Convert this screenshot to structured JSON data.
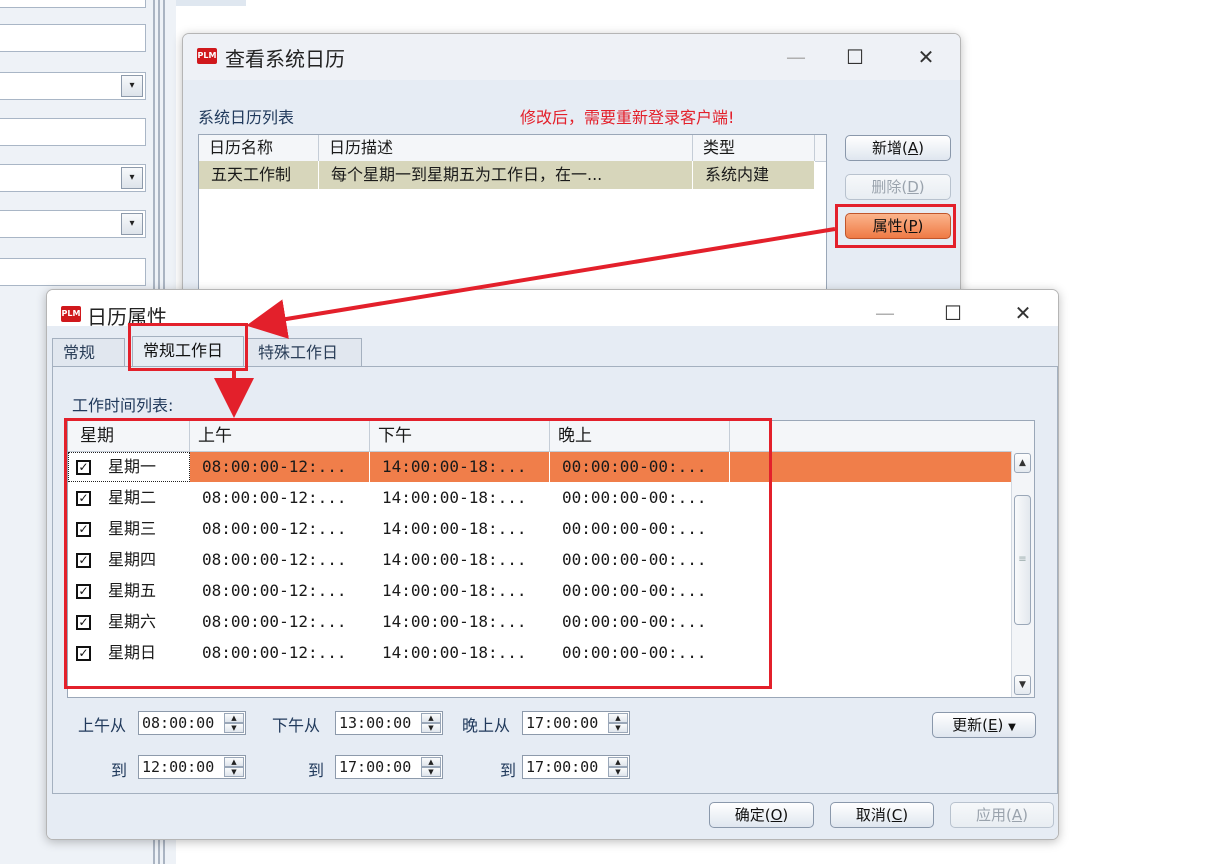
{
  "background": {
    "combo_arrow": "▾"
  },
  "system_calendar_window": {
    "title": "查看系统日历",
    "app_icon_text": "PLM",
    "list_label": "系统日历列表",
    "warning": "修改后，需要重新登录客户端!",
    "warning_color": "#e3202b",
    "columns": [
      "日历名称",
      "日历描述",
      "类型"
    ],
    "rows": [
      [
        "五天工作制",
        "每个星期一到星期五为工作日，在一...",
        "系统内建"
      ]
    ],
    "buttons": {
      "add": "新增",
      "add_key": "A",
      "delete": "删除",
      "delete_key": "D",
      "properties": "属性",
      "properties_key": "P"
    },
    "caption": {
      "minimize": "—",
      "maximize": "☐",
      "close": "✕"
    }
  },
  "calendar_props_window": {
    "title": "日历属性",
    "app_icon_text": "PLM",
    "tabs": [
      "常规",
      "常规工作日",
      "特殊工作日"
    ],
    "active_tab": "常规工作日",
    "list_label": "工作时间列表:",
    "columns": [
      "星期",
      "上午",
      "下午",
      "晚上"
    ],
    "rows": [
      {
        "day": "星期一",
        "am": "08:00:00-12:...",
        "pm": "14:00:00-18:...",
        "night": "00:00:00-00:...",
        "checked": true
      },
      {
        "day": "星期二",
        "am": "08:00:00-12:...",
        "pm": "14:00:00-18:...",
        "night": "00:00:00-00:...",
        "checked": true
      },
      {
        "day": "星期三",
        "am": "08:00:00-12:...",
        "pm": "14:00:00-18:...",
        "night": "00:00:00-00:...",
        "checked": true
      },
      {
        "day": "星期四",
        "am": "08:00:00-12:...",
        "pm": "14:00:00-18:...",
        "night": "00:00:00-00:...",
        "checked": true
      },
      {
        "day": "星期五",
        "am": "08:00:00-12:...",
        "pm": "14:00:00-18:...",
        "night": "00:00:00-00:...",
        "checked": true
      },
      {
        "day": "星期六",
        "am": "08:00:00-12:...",
        "pm": "14:00:00-18:...",
        "night": "00:00:00-00:...",
        "checked": true
      },
      {
        "day": "星期日",
        "am": "08:00:00-12:...",
        "pm": "14:00:00-18:...",
        "night": "00:00:00-00:...",
        "checked": true
      }
    ],
    "selection_color": "#f07e4a",
    "time_fields": {
      "am_from_label": "上午从",
      "am_from": "08:00:00",
      "pm_from_label": "下午从",
      "pm_from": "13:00:00",
      "night_from_label": "晚上从",
      "night_from": "17:00:00",
      "to_label": "到",
      "am_to": "12:00:00",
      "pm_to": "17:00:00",
      "night_to": "17:00:00"
    },
    "buttons": {
      "update": "更新",
      "update_key": "E",
      "ok": "确定",
      "ok_key": "O",
      "cancel": "取消",
      "cancel_key": "C",
      "apply": "应用",
      "apply_key": "A"
    },
    "caption": {
      "minimize": "—",
      "maximize": "☐",
      "close": "✕"
    }
  },
  "annotation_color": "#e3202b"
}
